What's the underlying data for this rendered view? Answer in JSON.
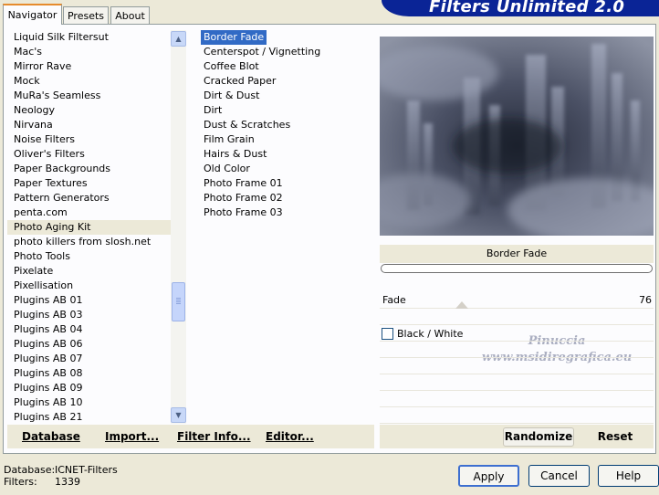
{
  "tabs": [
    "Navigator",
    "Presets",
    "About"
  ],
  "banner_title": "Filters Unlimited 2.0",
  "categories": [
    {
      "label": "Liquid Silk Filtersut"
    },
    {
      "label": "Mac's"
    },
    {
      "label": "Mirror Rave"
    },
    {
      "label": "Mock"
    },
    {
      "label": "MuRa's Seamless"
    },
    {
      "label": "Neology"
    },
    {
      "label": "Nirvana"
    },
    {
      "label": "Noise Filters"
    },
    {
      "label": "Oliver's Filters"
    },
    {
      "label": "Paper Backgrounds"
    },
    {
      "label": "Paper Textures"
    },
    {
      "label": "Pattern Generators"
    },
    {
      "label": "penta.com"
    },
    {
      "label": "Photo Aging Kit",
      "selected": true
    },
    {
      "label": "photo killers from slosh.net"
    },
    {
      "label": "Photo Tools"
    },
    {
      "label": "Pixelate"
    },
    {
      "label": "Pixellisation"
    },
    {
      "label": "Plugins AB 01"
    },
    {
      "label": "Plugins AB 03"
    },
    {
      "label": "Plugins AB 04"
    },
    {
      "label": "Plugins AB 06"
    },
    {
      "label": "Plugins AB 07"
    },
    {
      "label": "Plugins AB 08"
    },
    {
      "label": "Plugins AB 09"
    },
    {
      "label": "Plugins AB 10"
    },
    {
      "label": "Plugins AB 21"
    }
  ],
  "filters": [
    {
      "label": "Border Fade",
      "selected": true
    },
    {
      "label": "Centerspot / Vignetting"
    },
    {
      "label": "Coffee Blot"
    },
    {
      "label": "Cracked Paper"
    },
    {
      "label": "Dirt & Dust"
    },
    {
      "label": "Dirt"
    },
    {
      "label": "Dust & Scratches"
    },
    {
      "label": "Film Grain"
    },
    {
      "label": "Hairs & Dust"
    },
    {
      "label": "Old Color"
    },
    {
      "label": "Photo Frame 01"
    },
    {
      "label": "Photo Frame 02"
    },
    {
      "label": "Photo Frame 03"
    }
  ],
  "preview": {
    "watermark_line1": "Pinuccia",
    "watermark_line2": "www.msidiregrafica.eu"
  },
  "controls": {
    "filter_name": "Border Fade",
    "fade_label": "Fade",
    "fade_value": "76",
    "checkbox_label": "Black / White",
    "checkbox_checked": false
  },
  "panel_buttons": {
    "database": "Database",
    "import": "Import...",
    "filter_info": "Filter Info...",
    "editor": "Editor...",
    "randomize": "Randomize",
    "reset": "Reset"
  },
  "status": {
    "database_label": "Database:",
    "database_value": "ICNET-Filters",
    "filters_label": "Filters:",
    "filters_value": "1339"
  },
  "dialog_buttons": {
    "apply": "Apply",
    "cancel": "Cancel",
    "help": "Help"
  }
}
